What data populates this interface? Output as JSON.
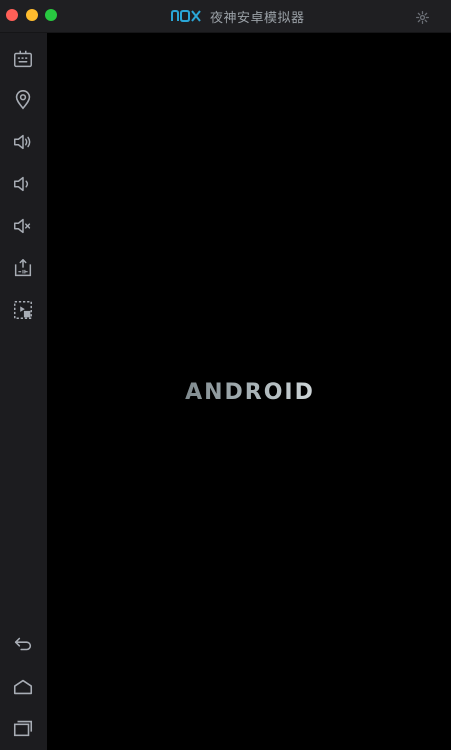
{
  "window": {
    "title": "夜神安卓模拟器",
    "logo_text": "nox"
  },
  "boot_screen": {
    "text": "ANDROID"
  },
  "sidebar": {
    "items": [
      {
        "id": "keyboard",
        "icon": "keyboard-icon"
      },
      {
        "id": "location",
        "icon": "location-pin-icon"
      },
      {
        "id": "volume-up",
        "icon": "volume-up-icon"
      },
      {
        "id": "volume-down",
        "icon": "volume-down-icon"
      },
      {
        "id": "mute",
        "icon": "volume-mute-icon"
      },
      {
        "id": "screenshot",
        "icon": "screenshot-icon"
      },
      {
        "id": "multi-instance",
        "icon": "multi-instance-icon"
      },
      {
        "id": "back",
        "icon": "back-icon"
      },
      {
        "id": "home",
        "icon": "home-icon"
      },
      {
        "id": "recents",
        "icon": "recents-icon"
      }
    ]
  },
  "colors": {
    "titlebar": "#1f1f22",
    "sidebar": "#1c1c1f",
    "icon": "#a8adb5",
    "nox_accent": "#2aa6d6",
    "screen": "#000000"
  }
}
